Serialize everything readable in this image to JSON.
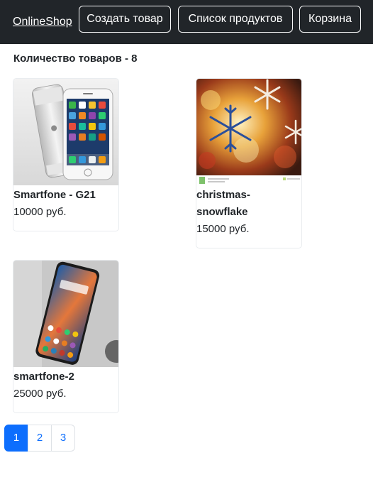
{
  "navbar": {
    "brand": "OnlineShop",
    "buttons": [
      {
        "label": "Создать товар"
      },
      {
        "label": "Список продуктов"
      },
      {
        "label": "Корзина"
      }
    ]
  },
  "catalog": {
    "count_text": "Количество товаров - 8",
    "products": [
      {
        "name": "Smartfone - G21",
        "price": "10000 руб."
      },
      {
        "name": "christmas-snowflake",
        "price": "15000 руб."
      },
      {
        "name": "smartfone-2",
        "price": "25000 руб."
      }
    ]
  },
  "pagination": {
    "pages": [
      "1",
      "2",
      "3"
    ],
    "active": "1"
  },
  "colors": {
    "navbar_bg": "#212529",
    "primary": "#0d6efd"
  }
}
